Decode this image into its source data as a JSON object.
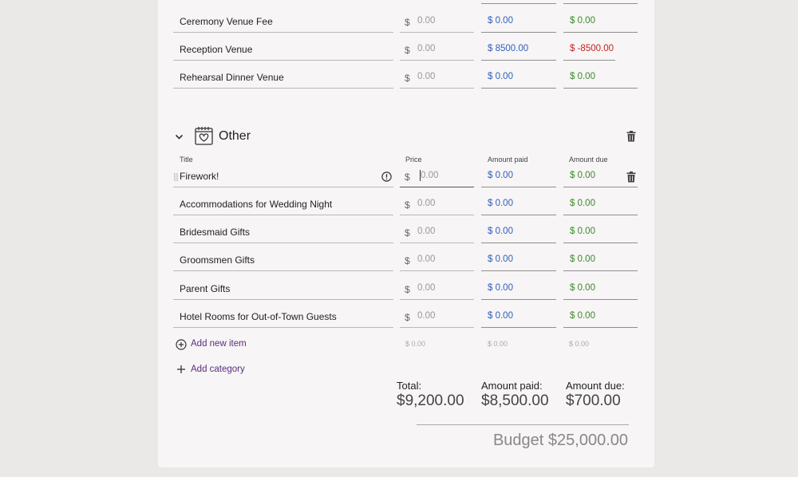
{
  "venue_rows": [
    {
      "title": "Ceremony Venue Fee",
      "price": "0.00",
      "paid": "$ 0.00",
      "due": "$ 0.00"
    },
    {
      "title": "Reception Venue",
      "price": "0.00",
      "paid": "$ 8500.00",
      "due": "$ -8500.00"
    },
    {
      "title": "Rehearsal Dinner Venue",
      "price": "0.00",
      "paid": "$ 0.00",
      "due": "$ 0.00"
    }
  ],
  "category": {
    "name": "Other",
    "icon": "calendar-heart-icon"
  },
  "columns": {
    "title": "Title",
    "price": "Price",
    "paid": "Amount paid",
    "due": "Amount due"
  },
  "currency_symbol": "$",
  "other_rows": [
    {
      "title": "Firework!",
      "price": "0.00",
      "paid": "$ 0.00",
      "due": "$ 0.00"
    },
    {
      "title": "Accommodations for Wedding Night",
      "price": "0.00",
      "paid": "$ 0.00",
      "due": "$ 0.00"
    },
    {
      "title": "Bridesmaid Gifts",
      "price": "0.00",
      "paid": "$ 0.00",
      "due": "$ 0.00"
    },
    {
      "title": "Groomsmen Gifts",
      "price": "0.00",
      "paid": "$ 0.00",
      "due": "$ 0.00"
    },
    {
      "title": "Parent Gifts",
      "price": "0.00",
      "paid": "$ 0.00",
      "due": "$ 0.00"
    },
    {
      "title": "Hotel Rooms for Out-of-Town Guests",
      "price": "0.00",
      "paid": "$ 0.00",
      "due": "$ 0.00"
    }
  ],
  "add_item_label": "Add new item",
  "subtotals": {
    "price": "$ 0.00",
    "paid": "$ 0.00",
    "due": "$ 0.00"
  },
  "add_category_label": "Add category",
  "totals": {
    "total_label": "Total:",
    "total_value": "$9,200.00",
    "paid_label": "Amount paid:",
    "paid_value": "$8,500.00",
    "due_label": "Amount due:",
    "due_value": "$700.00"
  },
  "budget_label": "Budget $25,000.00",
  "colors": {
    "paid": "#2f5fbf",
    "due": "#3a8a2a",
    "negative": "#c82020",
    "link": "#5a2d82"
  }
}
